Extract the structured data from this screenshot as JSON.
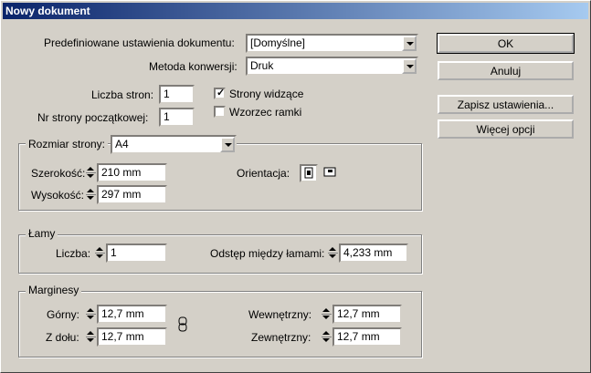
{
  "window": {
    "title": "Nowy dokument"
  },
  "preset": {
    "label": "Predefiniowane ustawienia dokumentu:",
    "value": "[Domyślne]"
  },
  "conversion": {
    "label": "Metoda konwersji:",
    "value": "Druk"
  },
  "pages": {
    "count_label": "Liczba stron:",
    "count_value": "1",
    "start_label": "Nr strony początkowej:",
    "start_value": "1",
    "facing_label": "Strony widzące",
    "facing_checked": true,
    "frame_label": "Wzorzec ramki",
    "frame_checked": false
  },
  "page_size": {
    "group_label": "Rozmiar strony:",
    "value": "A4",
    "width_label": "Szerokość:",
    "width_value": "210 mm",
    "height_label": "Wysokość:",
    "height_value": "297 mm",
    "orientation_label": "Orientacja:"
  },
  "columns": {
    "group_label": "Łamy",
    "count_label": "Liczba:",
    "count_value": "1",
    "gutter_label": "Odstęp między łamami:",
    "gutter_value": "4,233 mm"
  },
  "margins": {
    "group_label": "Marginesy",
    "top_label": "Górny:",
    "top_value": "12,7 mm",
    "bottom_label": "Z dołu:",
    "bottom_value": "12,7 mm",
    "inside_label": "Wewnętrzny:",
    "inside_value": "12,7 mm",
    "outside_label": "Zewnętrzny:",
    "outside_value": "12,7 mm"
  },
  "buttons": {
    "ok": "OK",
    "cancel": "Anuluj",
    "save": "Zapisz ustawienia...",
    "more": "Więcej opcji"
  }
}
